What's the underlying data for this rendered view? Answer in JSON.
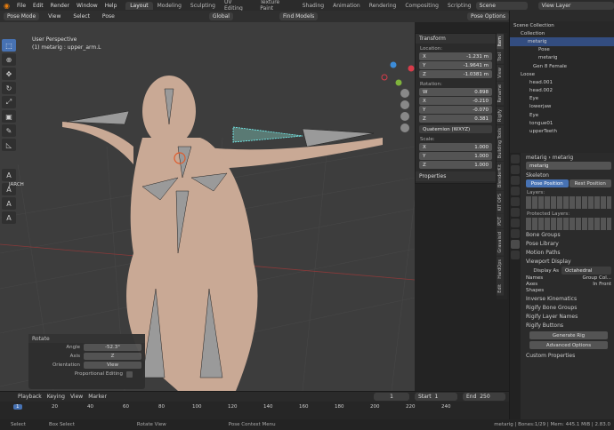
{
  "topbar": {
    "menus": [
      "File",
      "Edit",
      "Render",
      "Window",
      "Help"
    ],
    "workspaces": [
      "Layout",
      "Modeling",
      "Sculpting",
      "UV Editing",
      "Texture Paint",
      "Shading",
      "Animation",
      "Rendering",
      "Compositing",
      "Scripting"
    ],
    "scene": "Scene",
    "view_layer": "View Layer"
  },
  "header": {
    "mode": "Pose Mode",
    "menus": [
      "View",
      "Select",
      "Pose"
    ],
    "orientation": "Global",
    "find_models": "Find Models",
    "pose_options": "Pose Options"
  },
  "viewport": {
    "perspective": "User Perspective",
    "object": "(1) metarig : upper_arm.L",
    "toolshelf": "JARCH"
  },
  "npanel": {
    "title": "Transform",
    "location_label": "Location:",
    "loc": [
      {
        "axis": "X",
        "value": "-1.231 m"
      },
      {
        "axis": "Y",
        "value": "-1.9641 m"
      },
      {
        "axis": "Z",
        "value": "-1.0381 m"
      }
    ],
    "rotation_label": "Rotation:",
    "rot": [
      {
        "axis": "W",
        "value": "0.898"
      },
      {
        "axis": "X",
        "value": "-0.210"
      },
      {
        "axis": "Y",
        "value": "-0.070"
      },
      {
        "axis": "Z",
        "value": "0.381"
      }
    ],
    "rot_mode": "Quaternion (WXYZ)",
    "scale_label": "Scale:",
    "scale": [
      {
        "axis": "X",
        "value": "1.000"
      },
      {
        "axis": "Y",
        "value": "1.000"
      },
      {
        "axis": "Z",
        "value": "1.000"
      }
    ],
    "properties": "Properties"
  },
  "vtabs": [
    "Item",
    "Tool",
    "View",
    "Rename",
    "Rigify",
    "Building Tools",
    "BlenderKit",
    "KIT OPS",
    "PDT",
    "Gravaisid",
    "HardOps",
    "Edit"
  ],
  "outliner": {
    "rows": [
      "Scene Collection",
      "Collection",
      "metarig",
      "Pose",
      "metarig",
      "Gen 8 Female",
      "Loose",
      "head.001",
      "head.002",
      "Eye",
      "lowerjaw",
      "Eye",
      "tongue01",
      "upperTeeth"
    ]
  },
  "properties": {
    "breadcrumb1": "metarig",
    "breadcrumb2": "metarig",
    "object": "metarig",
    "skeleton": "Skeleton",
    "pose_position": "Pose Position",
    "rest_position": "Rest Position",
    "layers": "Layers:",
    "protected_layers": "Protected Layers:",
    "sections": [
      "Bone Groups",
      "Pose Library",
      "Motion Paths"
    ],
    "viewport_display": "Viewport Display",
    "display_as_label": "Display As",
    "display_as": "Octahedral",
    "names": "Names",
    "group_colors": "Group Col...",
    "axes": "Axes",
    "in_front": "In Front",
    "shapes": "Shapes",
    "sections2": [
      "Inverse Kinematics",
      "Rigify Bone Groups",
      "Rigify Layer Names"
    ],
    "rigify_buttons": "Rigify Buttons",
    "generate": "Generate Rig",
    "advanced": "Advanced Options",
    "custom": "Custom Properties"
  },
  "rotate_panel": {
    "title": "Rotate",
    "angle_label": "Angle",
    "angle": "-52.3°",
    "axis_label": "Axis",
    "axis": "Z",
    "orientation_label": "Orientation",
    "orientation": "View",
    "proportional": "Proportional Editing"
  },
  "timeline": {
    "menus": [
      "Playback",
      "Keying",
      "View",
      "Marker"
    ],
    "current": "1",
    "start_label": "Start",
    "start": "1",
    "end_label": "End",
    "end": "250",
    "ticks": [
      "1",
      "20",
      "40",
      "60",
      "80",
      "100",
      "120",
      "140",
      "160",
      "180",
      "200",
      "220",
      "240"
    ]
  },
  "status": {
    "select": "Select",
    "box": "Box Select",
    "rotate": "Rotate View",
    "context": "Pose Context Menu",
    "info": "metarig | Bones:1/29 | Mem: 445.1 MiB | 2.83.0"
  },
  "colors": {
    "accent": "#4772b3",
    "selection": "#f5a623",
    "skin": "#c9a995"
  }
}
